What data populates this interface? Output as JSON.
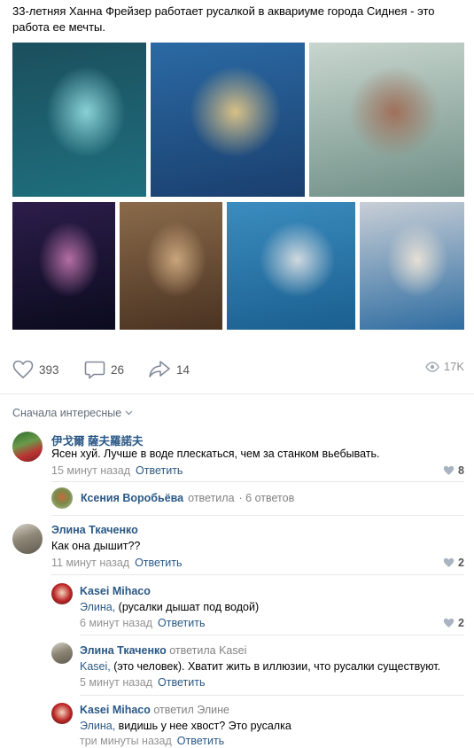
{
  "post": {
    "text": "33-летняя Ханна Фрейзер работает русалкой в аквариуме города Сиднея - это работа ее мечты.",
    "photos": [
      {
        "name": "photo-mermaid-tail-underwater",
        "colors": [
          "#1f6f7e",
          "#1b4f5d",
          "#89d1d6"
        ]
      },
      {
        "name": "photo-mermaid-blonde-shipwreck",
        "colors": [
          "#1a3f6e",
          "#2b6aa4",
          "#d7c087"
        ]
      },
      {
        "name": "photo-mermaid-aquarium-glass",
        "colors": [
          "#6f8f86",
          "#c8d6cf",
          "#a0705a"
        ]
      },
      {
        "name": "photo-mermaid-dark-water",
        "colors": [
          "#0b0b1e",
          "#2c1d4a",
          "#b46ea4"
        ]
      },
      {
        "name": "photo-mermaid-rock",
        "colors": [
          "#4a3322",
          "#8a6a4a",
          "#c9a57d"
        ]
      },
      {
        "name": "photo-mermaid-dome",
        "colors": [
          "#1a5f8f",
          "#3b8cbf",
          "#cfd9df"
        ]
      },
      {
        "name": "photo-headdress-portrait",
        "colors": [
          "#2f6da1",
          "#c8ced6",
          "#e6e0d6"
        ]
      }
    ]
  },
  "actions": {
    "likes": "393",
    "comments": "26",
    "shares": "14",
    "views": "17K"
  },
  "sort_label": "Сначала интересные",
  "comments": [
    {
      "author": "伊戈爾 薩夫羅諾夫",
      "text": "Ясен хуй. Лучше в воде плескаться, чем за станком вьебывать.",
      "time": "15 минут назад",
      "reply": "Ответить",
      "likes": "8"
    },
    {
      "thread_author": "Ксения Воробьёва",
      "thread_verb": "ответила",
      "thread_count": "· 6 ответов"
    },
    {
      "author": "Элина Ткаченко",
      "text": "Как она дышит??",
      "time": "11 минут назад",
      "reply": "Ответить",
      "likes": "2"
    },
    {
      "author": "Kasei Mihaco",
      "mention": "Элина,",
      "text": " (русалки дышат под водой)",
      "time": "6 минут назад",
      "reply": "Ответить",
      "likes": "2"
    },
    {
      "author": "Элина Ткаченко",
      "replied_to": "ответила Kasei",
      "mention": "Kasei,",
      "text": " (это человек). Хватит жить в иллюзии, что русалки существуют.",
      "time": "5 минут назад",
      "reply": "Ответить"
    },
    {
      "author": "Kasei Mihaco",
      "replied_to": "ответил Элине",
      "mention": "Элина,",
      "text": " видишь у нее хвост? Это русалка",
      "time": "три минуты назад",
      "reply": "Ответить"
    }
  ]
}
